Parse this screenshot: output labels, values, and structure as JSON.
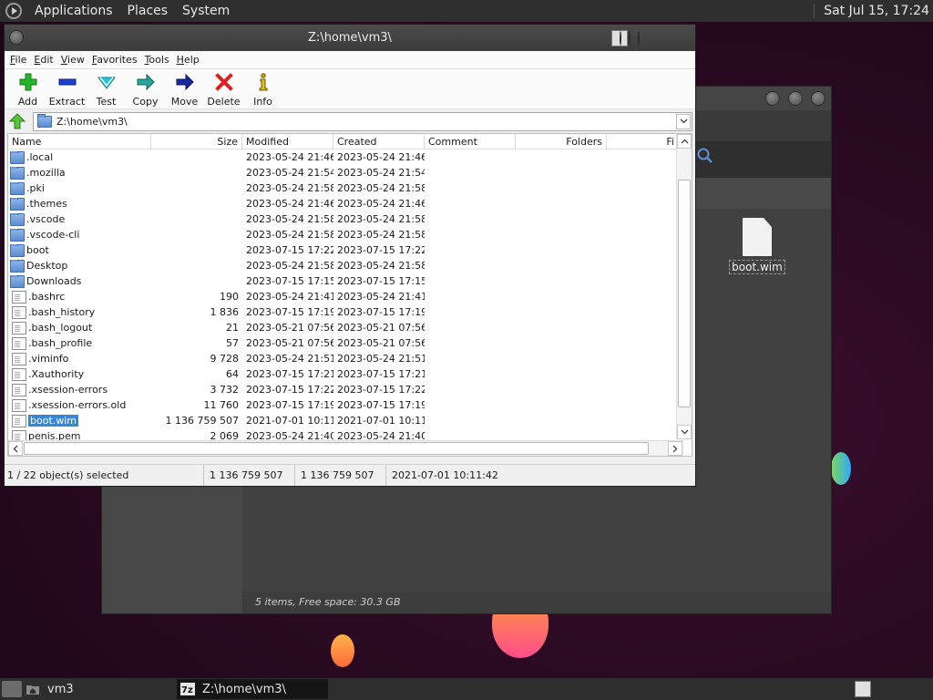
{
  "top_panel": {
    "menus": [
      "Applications",
      "Places",
      "System"
    ],
    "clock": "Sat Jul 15, 17:24"
  },
  "background_window": {
    "file_label": "boot.wim",
    "status": "5 items, Free space: 30.3 GB"
  },
  "window": {
    "title": "Z:\\home\\vm3\\"
  },
  "menubar": [
    "File",
    "Edit",
    "View",
    "Favorites",
    "Tools",
    "Help"
  ],
  "toolbar": [
    {
      "label": "Add",
      "icon": "add-icon"
    },
    {
      "label": "Extract",
      "icon": "extract-icon"
    },
    {
      "label": "Test",
      "icon": "test-icon"
    },
    {
      "label": "Copy",
      "icon": "copy-icon"
    },
    {
      "label": "Move",
      "icon": "move-icon"
    },
    {
      "label": "Delete",
      "icon": "delete-icon"
    },
    {
      "label": "Info",
      "icon": "info-icon"
    }
  ],
  "address": {
    "path": "Z:\\home\\vm3\\"
  },
  "columns": {
    "name": "Name",
    "size": "Size",
    "modified": "Modified",
    "created": "Created",
    "comment": "Comment",
    "folders": "Folders",
    "files": "Fi"
  },
  "files": [
    {
      "name": ".local",
      "type": "folder",
      "size": "",
      "modified": "2023-05-24 21:46",
      "created": "2023-05-24 21:46"
    },
    {
      "name": ".mozilla",
      "type": "folder",
      "size": "",
      "modified": "2023-05-24 21:54",
      "created": "2023-05-24 21:54"
    },
    {
      "name": ".pki",
      "type": "folder",
      "size": "",
      "modified": "2023-05-24 21:58",
      "created": "2023-05-24 21:58"
    },
    {
      "name": ".themes",
      "type": "folder",
      "size": "",
      "modified": "2023-05-24 21:46",
      "created": "2023-05-24 21:46"
    },
    {
      "name": ".vscode",
      "type": "folder",
      "size": "",
      "modified": "2023-05-24 21:58",
      "created": "2023-05-24 21:58"
    },
    {
      "name": ".vscode-cli",
      "type": "folder",
      "size": "",
      "modified": "2023-05-24 21:58",
      "created": "2023-05-24 21:58"
    },
    {
      "name": "boot",
      "type": "folder",
      "size": "",
      "modified": "2023-07-15 17:22",
      "created": "2023-07-15 17:22"
    },
    {
      "name": "Desktop",
      "type": "folder",
      "size": "",
      "modified": "2023-05-24 21:58",
      "created": "2023-05-24 21:58"
    },
    {
      "name": "Downloads",
      "type": "folder",
      "size": "",
      "modified": "2023-07-15 17:15",
      "created": "2023-07-15 17:15"
    },
    {
      "name": ".bashrc",
      "type": "file",
      "size": "190",
      "modified": "2023-05-24 21:41",
      "created": "2023-05-24 21:41"
    },
    {
      "name": ".bash_history",
      "type": "file",
      "size": "1 836",
      "modified": "2023-07-15 17:19",
      "created": "2023-07-15 17:19"
    },
    {
      "name": ".bash_logout",
      "type": "file",
      "size": "21",
      "modified": "2023-05-21 07:56",
      "created": "2023-05-21 07:56"
    },
    {
      "name": ".bash_profile",
      "type": "file",
      "size": "57",
      "modified": "2023-05-21 07:56",
      "created": "2023-05-21 07:56"
    },
    {
      "name": ".viminfo",
      "type": "file",
      "size": "9 728",
      "modified": "2023-05-24 21:51",
      "created": "2023-05-24 21:51"
    },
    {
      "name": ".Xauthority",
      "type": "file",
      "size": "64",
      "modified": "2023-07-15 17:21",
      "created": "2023-07-15 17:21"
    },
    {
      "name": ".xsession-errors",
      "type": "file",
      "size": "3 732",
      "modified": "2023-07-15 17:22",
      "created": "2023-07-15 17:22"
    },
    {
      "name": ".xsession-errors.old",
      "type": "file",
      "size": "11 760",
      "modified": "2023-07-15 17:19",
      "created": "2023-07-15 17:19"
    },
    {
      "name": "boot.wim",
      "type": "file",
      "size": "1 136 759 507",
      "modified": "2021-07-01 10:11",
      "created": "2021-07-01 10:11",
      "selected": true
    },
    {
      "name": "penis.pem",
      "type": "file",
      "size": "2 069",
      "modified": "2023-05-24 21:40",
      "created": "2023-05-24 21:40"
    }
  ],
  "status": {
    "selection": "1 / 22 object(s) selected",
    "total_size": "1 136 759 507",
    "selected_size": "1 136 759 507",
    "modified": "2021-07-01 10:11:42"
  },
  "taskbar": {
    "items": [
      {
        "label": "vm3",
        "icon": "home-folder-icon"
      },
      {
        "label": "Z:\\home\\vm3\\",
        "icon": "7zip-icon"
      }
    ]
  }
}
